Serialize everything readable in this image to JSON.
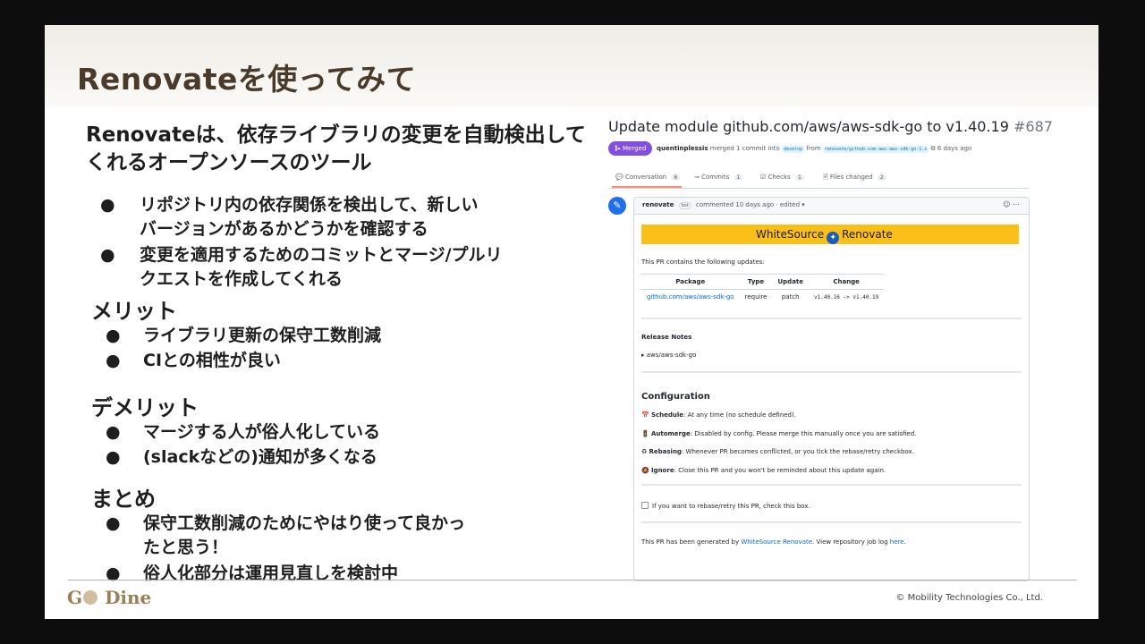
{
  "slide": {
    "title": "Renovateを使ってみて",
    "intro": "Renovateは、依存ライブラリの変更を自動検出してくれるオープンソースのツール",
    "intro_bullets": [
      {
        "line1": "リポジトリ内の依存関係を検出して、新しい",
        "line2": "バージョンがあるかどうかを確認する"
      },
      {
        "line1": "変更を適用するためのコミットとマージ/プルリ",
        "line2": "クエストを作成してくれる"
      }
    ],
    "merit_heading": "メリット",
    "merit_bullets": [
      "ライブラリ更新の保守工数削減",
      "CIとの相性が良い"
    ],
    "demerit_heading": "デメリット",
    "demerit_bullets": [
      "マージする人が俗人化している",
      "(slackなどの)通知が多くなる"
    ],
    "summary_heading": "まとめ",
    "summary_bullets": [
      {
        "line1": "保守工数削減のためにやはり使って良かっ",
        "line2": "たと思う！"
      },
      {
        "line1": "俗人化部分は運用見直しを検討中",
        "line2": ""
      }
    ],
    "bullet_char": "●",
    "logo_g": "G",
    "logo_rest": "Dine",
    "copyright": "© Mobility Technologies Co., Ltd."
  },
  "pr": {
    "title": "Update module github.com/aws/aws-sdk-go to v1.40.19",
    "number": "#687",
    "badge": "Merged",
    "badge_icon": "merge-icon",
    "author": "quentinplessis",
    "merged_text": "merged 1 commit into",
    "base_branch": "develop",
    "from_text": "from",
    "head_branch": "renovate/github.com-aws-aws-sdk-go-1.x",
    "ago": "6 days ago",
    "tabs": [
      {
        "icon": "conversation-icon",
        "label": "Conversation",
        "count": "6"
      },
      {
        "icon": "commits-icon",
        "label": "Commits",
        "count": "1"
      },
      {
        "icon": "checks-icon",
        "label": "Checks",
        "count": "1"
      },
      {
        "icon": "files-icon",
        "label": "Files changed",
        "count": "2"
      }
    ],
    "comment": {
      "user": "renovate",
      "bot_label": "bot",
      "meta": "commented 10 days ago",
      "edited": "· edited ▾",
      "banner_left": "WhiteSource",
      "banner_right": "Renovate",
      "contains": "This PR contains the following updates:",
      "table": {
        "headers": [
          "Package",
          "Type",
          "Update",
          "Change"
        ],
        "rows": [
          [
            "github.com/aws/aws-sdk-go",
            "require",
            "patch",
            "v1.40.16 -> v1.40.19"
          ]
        ]
      },
      "release_notes": "Release Notes",
      "release_item": "aws/aws-sdk-go",
      "config_title": "Configuration",
      "config": [
        {
          "emoji": "📅",
          "label": "Schedule",
          "text": ": At any time (no schedule defined)."
        },
        {
          "emoji": "🚦",
          "label": "Automerge",
          "text": ": Disabled by config. Please merge this manually once you are satisfied."
        },
        {
          "emoji": "♻",
          "label": "Rebasing",
          "text": ": Whenever PR becomes conflicted, or you tick the rebase/retry checkbox."
        },
        {
          "emoji": "🔕",
          "label": "Ignore",
          "text": ": Close this PR and you won't be reminded about this update again."
        }
      ],
      "checkbox_text": "If you want to rebase/retry this PR, check this box.",
      "generated_prefix": "This PR has been generated by",
      "generated_link": "WhiteSource Renovate",
      "generated_mid": ". View repository job log",
      "generated_here": "here",
      "generated_end": "."
    }
  },
  "colors": {
    "merged": "#8250df",
    "banner": "#fbbf19",
    "title": "#4a3a2a",
    "link": "#0969da"
  }
}
